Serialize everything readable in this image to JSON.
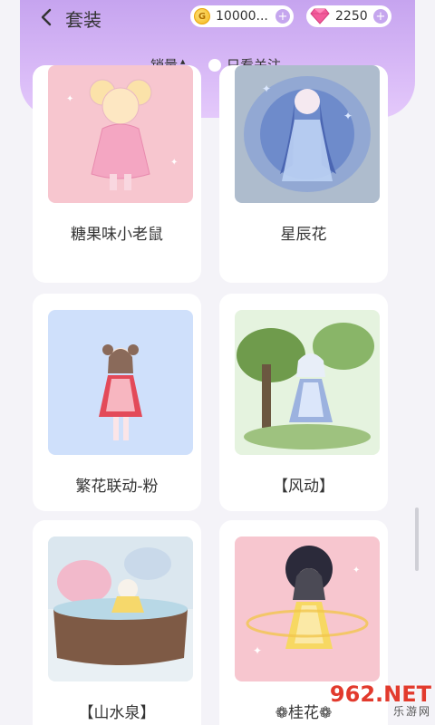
{
  "header": {
    "title": "套装",
    "coins": {
      "value": "10000...",
      "icon": "coin-icon"
    },
    "gems": {
      "value": "2250",
      "icon": "gem-icon"
    }
  },
  "filter": {
    "sort_label": "销量",
    "only_follow_label": "只看关注"
  },
  "items": [
    {
      "name": "糖果味小老鼠",
      "bg": "#f7c6cf"
    },
    {
      "name": "星辰花",
      "bg": "#aebccd"
    },
    {
      "name": "繁花联动-粉",
      "bg": "#cfe0fb"
    },
    {
      "name": "【风动】",
      "bg": "#e5f3df"
    },
    {
      "name": "【山水泉】",
      "bg": "#e9f0f4"
    },
    {
      "name": "❁桂花❁",
      "bg": "#f7c6cf"
    }
  ],
  "watermark": {
    "main": "962.NET",
    "sub": "乐游网"
  },
  "colors": {
    "accent": "#c6a4ef",
    "card_bg": "#ffffff",
    "page_bg": "#f4f3f8"
  }
}
